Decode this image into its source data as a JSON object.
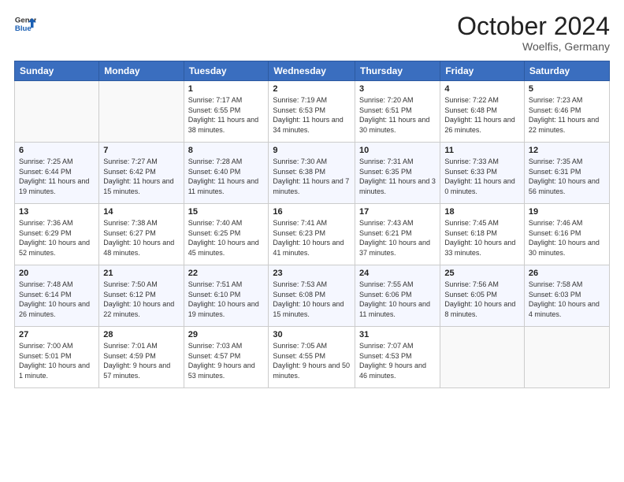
{
  "header": {
    "logo_line1": "General",
    "logo_line2": "Blue",
    "month_title": "October 2024",
    "location": "Woelfis, Germany"
  },
  "days_of_week": [
    "Sunday",
    "Monday",
    "Tuesday",
    "Wednesday",
    "Thursday",
    "Friday",
    "Saturday"
  ],
  "weeks": [
    [
      {
        "day": "",
        "sunrise": "",
        "sunset": "",
        "daylight": ""
      },
      {
        "day": "",
        "sunrise": "",
        "sunset": "",
        "daylight": ""
      },
      {
        "day": "1",
        "sunrise": "Sunrise: 7:17 AM",
        "sunset": "Sunset: 6:55 PM",
        "daylight": "Daylight: 11 hours and 38 minutes."
      },
      {
        "day": "2",
        "sunrise": "Sunrise: 7:19 AM",
        "sunset": "Sunset: 6:53 PM",
        "daylight": "Daylight: 11 hours and 34 minutes."
      },
      {
        "day": "3",
        "sunrise": "Sunrise: 7:20 AM",
        "sunset": "Sunset: 6:51 PM",
        "daylight": "Daylight: 11 hours and 30 minutes."
      },
      {
        "day": "4",
        "sunrise": "Sunrise: 7:22 AM",
        "sunset": "Sunset: 6:48 PM",
        "daylight": "Daylight: 11 hours and 26 minutes."
      },
      {
        "day": "5",
        "sunrise": "Sunrise: 7:23 AM",
        "sunset": "Sunset: 6:46 PM",
        "daylight": "Daylight: 11 hours and 22 minutes."
      }
    ],
    [
      {
        "day": "6",
        "sunrise": "Sunrise: 7:25 AM",
        "sunset": "Sunset: 6:44 PM",
        "daylight": "Daylight: 11 hours and 19 minutes."
      },
      {
        "day": "7",
        "sunrise": "Sunrise: 7:27 AM",
        "sunset": "Sunset: 6:42 PM",
        "daylight": "Daylight: 11 hours and 15 minutes."
      },
      {
        "day": "8",
        "sunrise": "Sunrise: 7:28 AM",
        "sunset": "Sunset: 6:40 PM",
        "daylight": "Daylight: 11 hours and 11 minutes."
      },
      {
        "day": "9",
        "sunrise": "Sunrise: 7:30 AM",
        "sunset": "Sunset: 6:38 PM",
        "daylight": "Daylight: 11 hours and 7 minutes."
      },
      {
        "day": "10",
        "sunrise": "Sunrise: 7:31 AM",
        "sunset": "Sunset: 6:35 PM",
        "daylight": "Daylight: 11 hours and 3 minutes."
      },
      {
        "day": "11",
        "sunrise": "Sunrise: 7:33 AM",
        "sunset": "Sunset: 6:33 PM",
        "daylight": "Daylight: 11 hours and 0 minutes."
      },
      {
        "day": "12",
        "sunrise": "Sunrise: 7:35 AM",
        "sunset": "Sunset: 6:31 PM",
        "daylight": "Daylight: 10 hours and 56 minutes."
      }
    ],
    [
      {
        "day": "13",
        "sunrise": "Sunrise: 7:36 AM",
        "sunset": "Sunset: 6:29 PM",
        "daylight": "Daylight: 10 hours and 52 minutes."
      },
      {
        "day": "14",
        "sunrise": "Sunrise: 7:38 AM",
        "sunset": "Sunset: 6:27 PM",
        "daylight": "Daylight: 10 hours and 48 minutes."
      },
      {
        "day": "15",
        "sunrise": "Sunrise: 7:40 AM",
        "sunset": "Sunset: 6:25 PM",
        "daylight": "Daylight: 10 hours and 45 minutes."
      },
      {
        "day": "16",
        "sunrise": "Sunrise: 7:41 AM",
        "sunset": "Sunset: 6:23 PM",
        "daylight": "Daylight: 10 hours and 41 minutes."
      },
      {
        "day": "17",
        "sunrise": "Sunrise: 7:43 AM",
        "sunset": "Sunset: 6:21 PM",
        "daylight": "Daylight: 10 hours and 37 minutes."
      },
      {
        "day": "18",
        "sunrise": "Sunrise: 7:45 AM",
        "sunset": "Sunset: 6:18 PM",
        "daylight": "Daylight: 10 hours and 33 minutes."
      },
      {
        "day": "19",
        "sunrise": "Sunrise: 7:46 AM",
        "sunset": "Sunset: 6:16 PM",
        "daylight": "Daylight: 10 hours and 30 minutes."
      }
    ],
    [
      {
        "day": "20",
        "sunrise": "Sunrise: 7:48 AM",
        "sunset": "Sunset: 6:14 PM",
        "daylight": "Daylight: 10 hours and 26 minutes."
      },
      {
        "day": "21",
        "sunrise": "Sunrise: 7:50 AM",
        "sunset": "Sunset: 6:12 PM",
        "daylight": "Daylight: 10 hours and 22 minutes."
      },
      {
        "day": "22",
        "sunrise": "Sunrise: 7:51 AM",
        "sunset": "Sunset: 6:10 PM",
        "daylight": "Daylight: 10 hours and 19 minutes."
      },
      {
        "day": "23",
        "sunrise": "Sunrise: 7:53 AM",
        "sunset": "Sunset: 6:08 PM",
        "daylight": "Daylight: 10 hours and 15 minutes."
      },
      {
        "day": "24",
        "sunrise": "Sunrise: 7:55 AM",
        "sunset": "Sunset: 6:06 PM",
        "daylight": "Daylight: 10 hours and 11 minutes."
      },
      {
        "day": "25",
        "sunrise": "Sunrise: 7:56 AM",
        "sunset": "Sunset: 6:05 PM",
        "daylight": "Daylight: 10 hours and 8 minutes."
      },
      {
        "day": "26",
        "sunrise": "Sunrise: 7:58 AM",
        "sunset": "Sunset: 6:03 PM",
        "daylight": "Daylight: 10 hours and 4 minutes."
      }
    ],
    [
      {
        "day": "27",
        "sunrise": "Sunrise: 7:00 AM",
        "sunset": "Sunset: 5:01 PM",
        "daylight": "Daylight: 10 hours and 1 minute."
      },
      {
        "day": "28",
        "sunrise": "Sunrise: 7:01 AM",
        "sunset": "Sunset: 4:59 PM",
        "daylight": "Daylight: 9 hours and 57 minutes."
      },
      {
        "day": "29",
        "sunrise": "Sunrise: 7:03 AM",
        "sunset": "Sunset: 4:57 PM",
        "daylight": "Daylight: 9 hours and 53 minutes."
      },
      {
        "day": "30",
        "sunrise": "Sunrise: 7:05 AM",
        "sunset": "Sunset: 4:55 PM",
        "daylight": "Daylight: 9 hours and 50 minutes."
      },
      {
        "day": "31",
        "sunrise": "Sunrise: 7:07 AM",
        "sunset": "Sunset: 4:53 PM",
        "daylight": "Daylight: 9 hours and 46 minutes."
      },
      {
        "day": "",
        "sunrise": "",
        "sunset": "",
        "daylight": ""
      },
      {
        "day": "",
        "sunrise": "",
        "sunset": "",
        "daylight": ""
      }
    ]
  ]
}
